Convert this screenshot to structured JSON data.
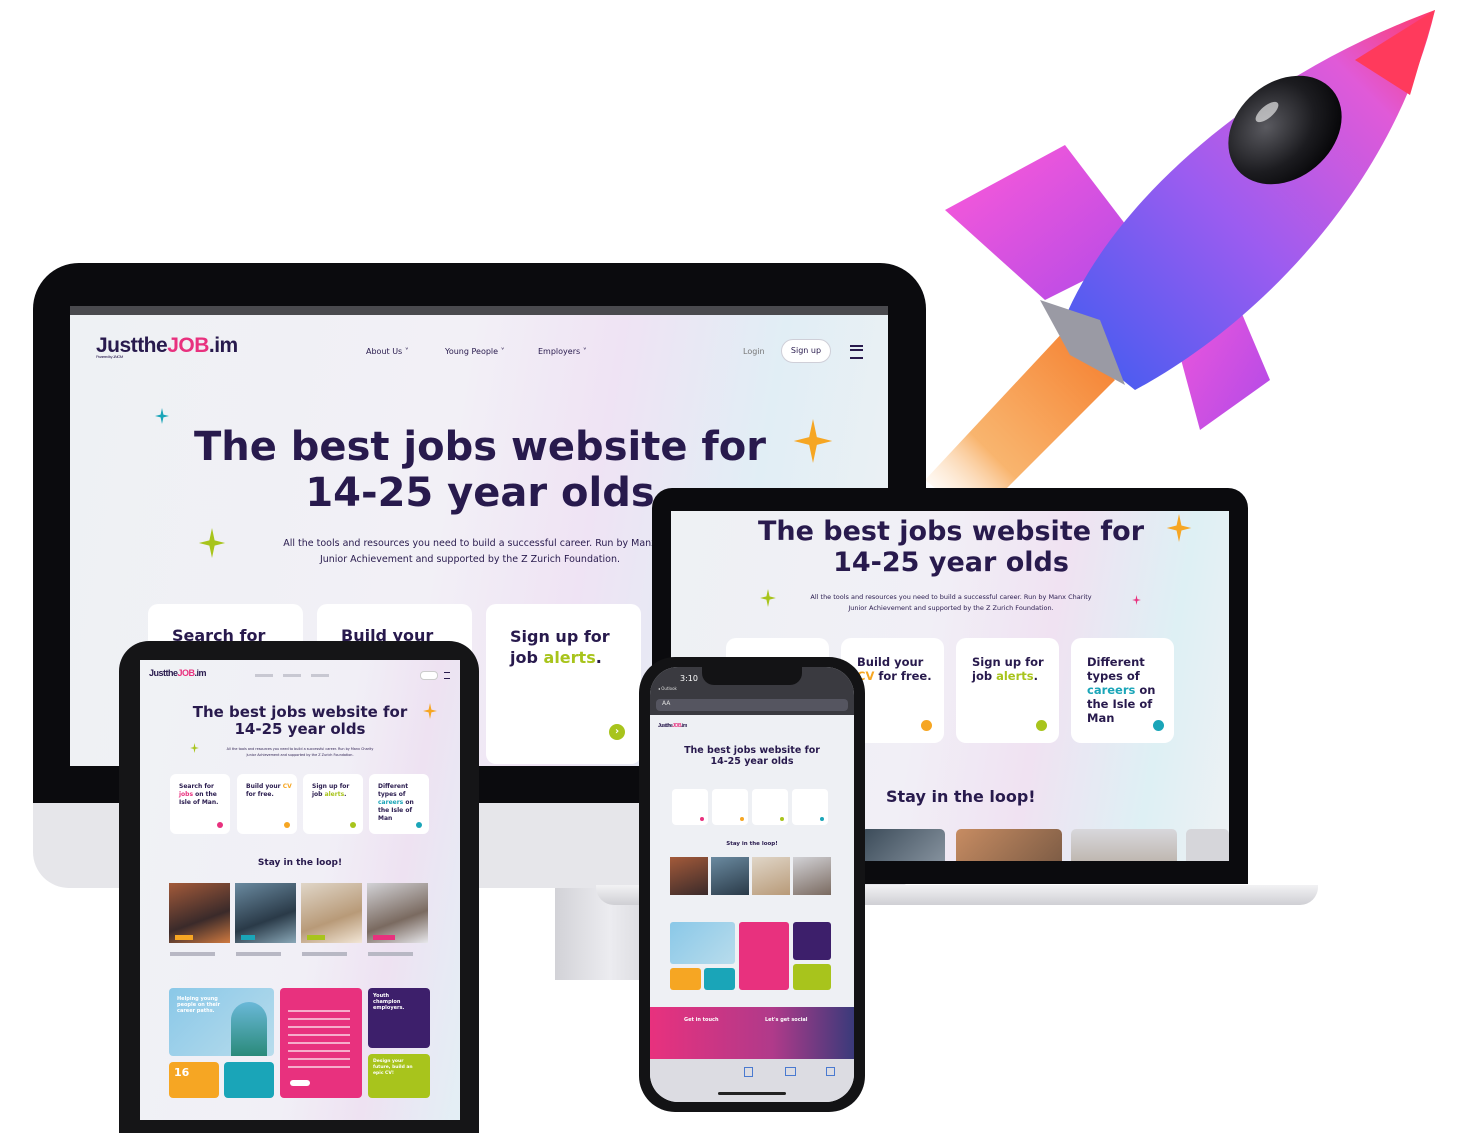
{
  "brand": {
    "logo_part1": "Just",
    "logo_part2": "the",
    "logo_part3": "JOB",
    "logo_part4": ".im",
    "logo_tagline": "Powered by JA IOM"
  },
  "nav": {
    "items": [
      "About Us",
      "Young People",
      "Employers"
    ],
    "login": "Login",
    "signup": "Sign up"
  },
  "hero": {
    "title_line1": "The best jobs website for",
    "title_line2": "14-25 year olds",
    "subtitle_line1": "All the tools and resources you need to build a successful career. Run by Manx Charity",
    "subtitle_line2": "Junior Achievement and supported by the Z Zurich Foundation.",
    "desktop_subtitle_line1": "All the tools and resources you need to build a successful career. Run by Manx",
    "desktop_subtitle_line2": "Junior Achievement and supported by the Z Zurich Foundation."
  },
  "cards": {
    "search": {
      "pre": "Search for",
      "accent": "jobs",
      "post": "on the Isle of Man."
    },
    "cv": {
      "pre": "Build your",
      "accent": "CV",
      "post": "for free."
    },
    "alerts": {
      "pre": "Sign up for job",
      "accent": "alerts",
      "post": "."
    },
    "careers": {
      "pre": "Different types of",
      "accent": "careers",
      "post": "on the Isle of Man"
    }
  },
  "desktop_cards_cut": {
    "search": "Search for",
    "cv": "Build your",
    "alerts_line1": "Sign up for",
    "alerts_line2": "job",
    "alerts_accent": "alerts",
    "alerts_post": "."
  },
  "laptop_cards": {
    "cv_line1": "Build your",
    "cv_accent": "CV",
    "cv_post": " for free.",
    "alerts_line1": "Sign up for",
    "alerts_line2": "job",
    "alerts_accent": "alerts",
    "alerts_post": ".",
    "careers_line1": "Different",
    "careers_line2": "types of",
    "careers_accent": "careers",
    "careers_on": " on",
    "careers_line4": "the Isle of",
    "careers_line5": "Man"
  },
  "loop": {
    "title": "Stay in the loop!"
  },
  "phone": {
    "time": "3:10",
    "back": "◂ Outlook",
    "address": "AA",
    "footer_left": "Get in touch",
    "footer_right": "Let's get social"
  },
  "tablet_promo": {
    "young": "Helping young people on their career paths.",
    "youth": "Youth champion employers.",
    "sixteen": "16",
    "green": "Design your future, build an epic CV!"
  },
  "colors": {
    "navy": "#281a4d",
    "pink": "#e8317e",
    "lime": "#a8c41c",
    "teal": "#1aa5b8",
    "orange": "#f6a623",
    "purple": "#3d1f6b"
  }
}
